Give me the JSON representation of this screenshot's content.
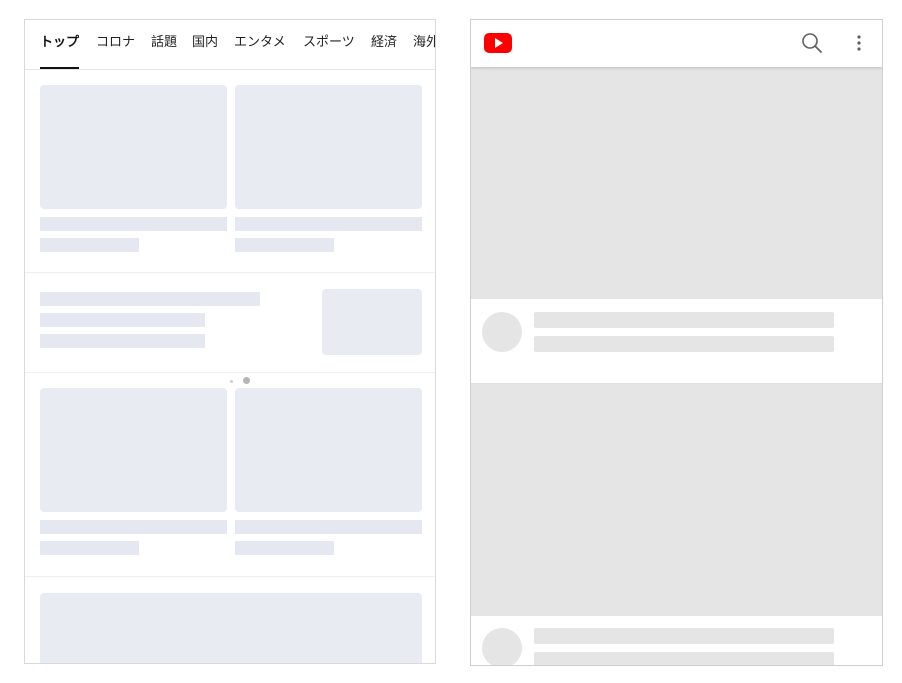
{
  "news_panel": {
    "tabs": [
      {
        "label": "トップ",
        "active": true
      },
      {
        "label": "コロナ",
        "active": false
      },
      {
        "label": "話題",
        "active": false
      },
      {
        "label": "国内",
        "active": false
      },
      {
        "label": "エンタメ",
        "active": false
      },
      {
        "label": "スポーツ",
        "active": false
      },
      {
        "label": "経済",
        "active": false
      },
      {
        "label": "海外",
        "active": false
      }
    ],
    "state": "loading-skeleton"
  },
  "youtube_panel": {
    "logo_icon": "youtube-logo-icon",
    "search_icon": "search-icon",
    "more_icon": "more-vert-icon",
    "brand_color": "#ff0000",
    "state": "loading-skeleton"
  }
}
